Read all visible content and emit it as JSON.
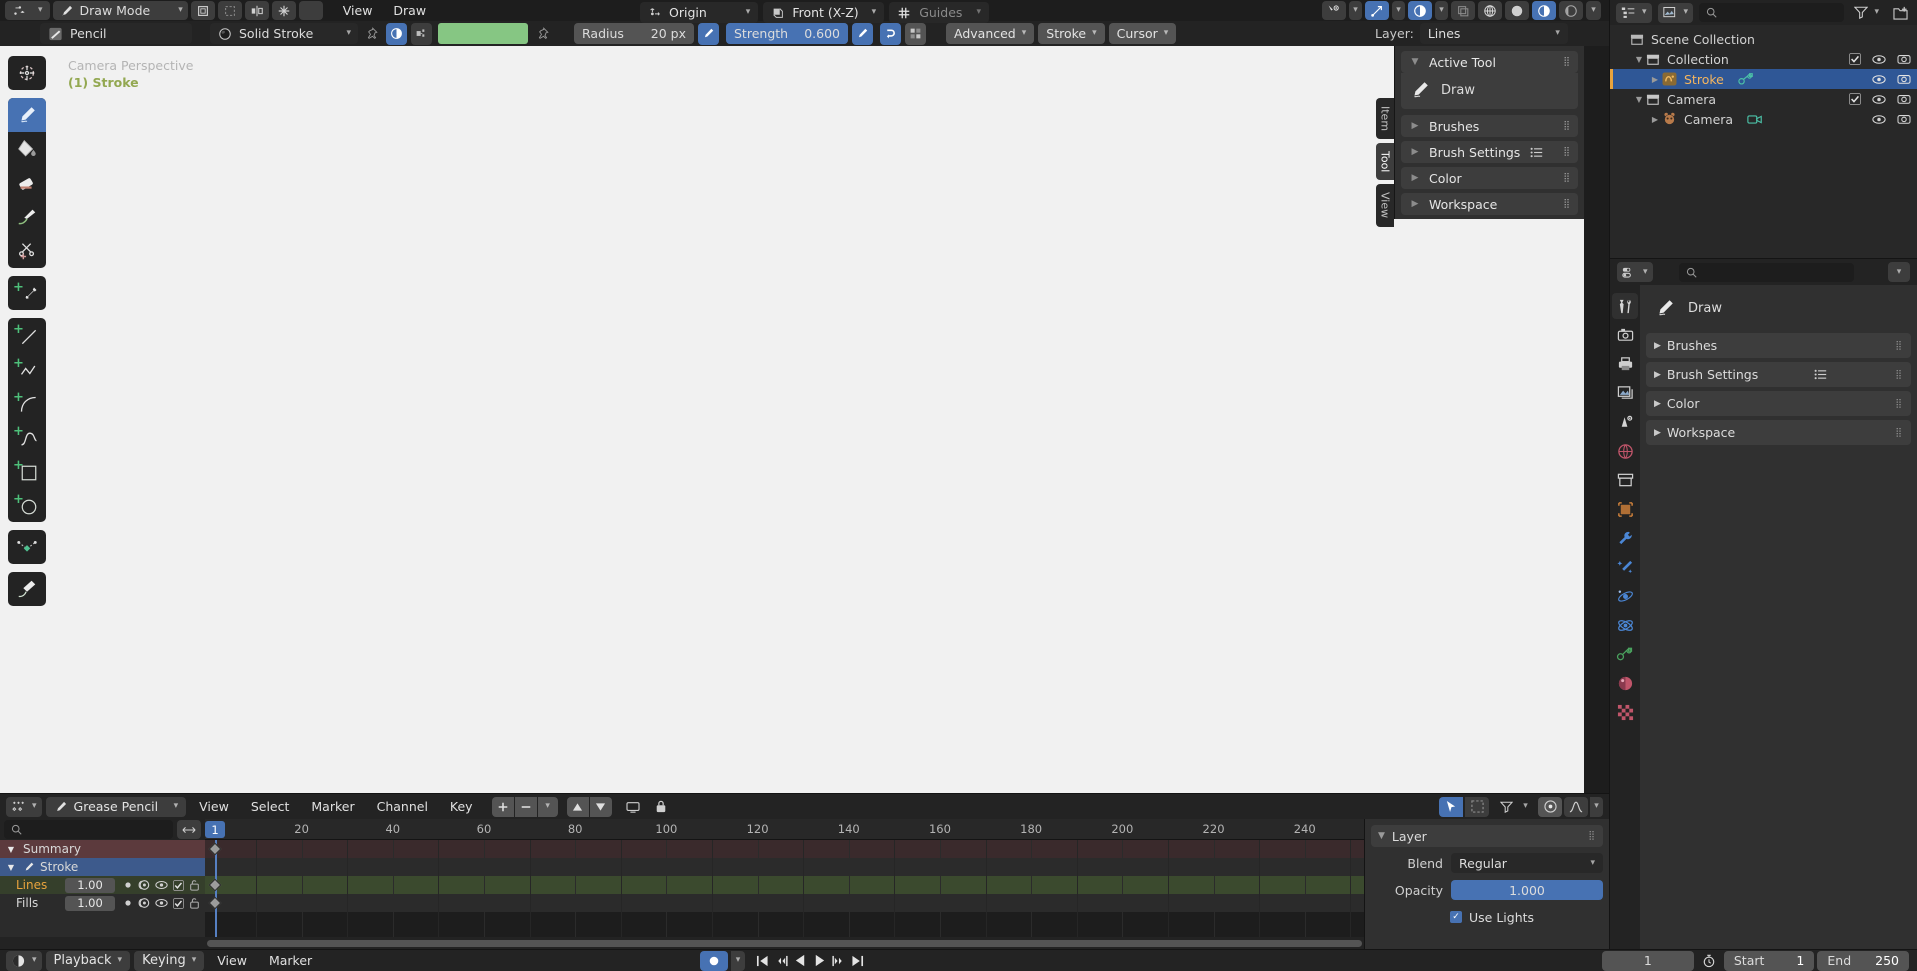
{
  "topbar": {
    "mode_label": "Draw Mode",
    "menus": [
      "View",
      "Draw"
    ],
    "icons": [
      "editor-type-icon",
      "mode-chevron-icon",
      "object-copy-icon",
      "select-set-icon",
      "mirror-icon",
      "snap-magnet-icon",
      "onion-skin-icon"
    ],
    "right_icons": [
      "visibility-selector-icon",
      "gizmo-icon",
      "overlays-icon",
      "xray-icon",
      "shading-wireframe-icon",
      "shading-solid-icon",
      "shading-material-icon",
      "shading-rendered-icon",
      "shading-chevron-icon"
    ]
  },
  "toolheader": {
    "brush_icon": "brush-preview-icon",
    "brush_name": "Pencil",
    "material_icon": "material-sphere-icon",
    "material_name": "Solid Stroke",
    "pin_icon": "pin-icon",
    "pressure_icon": "pressure-toggle-icon",
    "unlink_icon": "unlink-material-icon",
    "color_swatch": "#86c683",
    "color_pin_icon": "pin-icon",
    "radius_label": "Radius",
    "radius_value": "20 px",
    "radius_pressure_icon": "pressure-pen-icon",
    "strength_label": "Strength",
    "strength_value": "0.600",
    "strength_pressure_icon": "pressure-pen-icon",
    "caps_icon": "stroke-caps-icon",
    "blend_icon": "blend-mode-icon",
    "popovers": [
      "Advanced",
      "Stroke",
      "Cursor"
    ],
    "layer_label": "Layer:",
    "layer_value": "Lines"
  },
  "viewport": {
    "camera_text": "Camera Perspective",
    "object_text": "(1) Stroke",
    "background": "#f1f1f1",
    "tools": [
      {
        "name": "cursor-tool",
        "icon": "cursor-icon",
        "active": false
      },
      {
        "name": "draw-tool",
        "icon": "pencil-icon",
        "active": true
      },
      {
        "name": "fill-tool",
        "icon": "fill-bucket-icon",
        "active": false
      },
      {
        "name": "erase-tool",
        "icon": "eraser-icon",
        "active": false
      },
      {
        "name": "tint-tool",
        "icon": "tint-brush-icon",
        "active": false
      },
      {
        "name": "cutter-tool",
        "icon": "scissors-icon",
        "active": false
      },
      {
        "name": "eyedropper-tool",
        "icon": "eyedropper-icon",
        "active": false
      },
      {
        "name": "line-tool",
        "icon": "line-icon",
        "active": false
      },
      {
        "name": "polyline-tool",
        "icon": "polyline-icon",
        "active": false
      },
      {
        "name": "arc-tool",
        "icon": "arc-icon",
        "active": false
      },
      {
        "name": "curve-tool",
        "icon": "curve-icon",
        "active": false
      },
      {
        "name": "box-tool",
        "icon": "box-icon",
        "active": false
      },
      {
        "name": "circle-tool",
        "icon": "circle-icon",
        "active": false
      },
      {
        "name": "interpolate-tool",
        "icon": "interpolate-icon",
        "active": false
      },
      {
        "name": "annotate-tool",
        "icon": "annotate-icon",
        "active": false
      }
    ],
    "transform_pivot": "Origin",
    "view_orientation": "Front (X-Z)",
    "guides": "Guides"
  },
  "npanel": {
    "tabs": [
      "Item",
      "Tool",
      "View"
    ],
    "selected_tab": "Tool",
    "active_tool_header": "Active Tool",
    "active_tool_name": "Draw",
    "panels": [
      "Brushes",
      "Brush Settings",
      "Color",
      "Workspace"
    ]
  },
  "outliner": {
    "display_mode_icon": "outliner-display-mode-icon",
    "filter_icon": "filter-funnel-icon",
    "new_collection_icon": "new-collection-icon",
    "search_placeholder": "",
    "search_value": "",
    "rows": [
      {
        "label": "Scene Collection",
        "icon": "collection-icon",
        "indent": 0,
        "expand": "",
        "selected": false,
        "checkbox": false,
        "eye": false,
        "camera": false
      },
      {
        "label": "Collection",
        "icon": "collection-icon",
        "indent": 1,
        "expand": "down",
        "selected": false,
        "checkbox": true,
        "eye": true,
        "camera": true
      },
      {
        "label": "Stroke",
        "icon": "grease-pencil-data-icon",
        "indent": 2,
        "expand": "right",
        "selected": true,
        "checkbox": false,
        "eye": true,
        "camera": true,
        "extra_icon": "grease-pencil-object-icon"
      },
      {
        "label": "Camera",
        "icon": "collection-icon",
        "indent": 1,
        "expand": "down",
        "selected": false,
        "checkbox": true,
        "eye": true,
        "camera": true
      },
      {
        "label": "Camera",
        "icon": "camera-object-icon",
        "indent": 2,
        "expand": "right",
        "selected": false,
        "checkbox": false,
        "eye": true,
        "camera": true,
        "extra_icon": "camera-data-icon"
      }
    ]
  },
  "properties": {
    "editor_icon": "properties-editor-icon",
    "search_placeholder": "",
    "search_value": "",
    "tabs": [
      {
        "name": "tool-tab",
        "icon": "tool-wrench-screwdriver-icon",
        "selected": true,
        "color": "#d8d8d8"
      },
      {
        "name": "render-tab",
        "icon": "render-camera-back-icon",
        "selected": false,
        "color": "#d8d8d8"
      },
      {
        "name": "output-tab",
        "icon": "printer-icon",
        "selected": false,
        "color": "#d8d8d8"
      },
      {
        "name": "viewlayer-tab",
        "icon": "images-icon",
        "selected": false,
        "color": "#d8d8d8"
      },
      {
        "name": "scene-tab",
        "icon": "scene-cone-icon",
        "selected": false,
        "color": "#d8d8d8"
      },
      {
        "name": "world-tab",
        "icon": "world-globe-icon",
        "selected": false,
        "color": "#c0556a"
      },
      {
        "name": "collection-tab",
        "icon": "collection-box-icon",
        "selected": false,
        "color": "#d8d8d8"
      },
      {
        "name": "object-tab",
        "icon": "object-square-icon",
        "selected": false,
        "color": "#e08a3c"
      },
      {
        "name": "modifier-tab",
        "icon": "wrench-icon",
        "selected": false,
        "color": "#4b87d6"
      },
      {
        "name": "effects-tab",
        "icon": "sparkle-wand-icon",
        "selected": false,
        "color": "#4b87d6"
      },
      {
        "name": "particles-tab",
        "icon": "particles-icon",
        "selected": false,
        "color": "#4b87d6"
      },
      {
        "name": "physics-tab",
        "icon": "physics-orbit-icon",
        "selected": false,
        "color": "#4b87d6"
      },
      {
        "name": "data-tab",
        "icon": "grease-pencil-data-icon",
        "selected": false,
        "color": "#4aa35f"
      },
      {
        "name": "material-tab",
        "icon": "material-sphere-icon",
        "selected": false,
        "color": "#c0556a"
      },
      {
        "name": "texture-tab",
        "icon": "texture-checker-icon",
        "selected": false,
        "color": "#c0556a"
      }
    ],
    "active_tool_name": "Draw",
    "panels": [
      "Brushes",
      "Brush Settings",
      "Color",
      "Workspace"
    ]
  },
  "dopesheet": {
    "editor_icon": "dopesheet-editor-icon",
    "mode_icon": "grease-pencil-mode-icon",
    "mode_label": "Grease Pencil",
    "menus": [
      "View",
      "Select",
      "Marker",
      "Channel",
      "Key"
    ],
    "header_icons": [
      "add-keyframe-icon",
      "remove-keyframe-icon",
      "keyframe-chevron-icon",
      "move-up-icon",
      "move-down-icon",
      "only-show-selected-icon",
      "lock-icon"
    ],
    "right_icons": [
      "cursor-select-icon",
      "box-select-icon",
      "filter-funnel-icon",
      "proportional-edit-icon",
      "falloff-curve-icon"
    ],
    "search_placeholder": "",
    "search_value": "",
    "resize_icon": "horizontal-resize-icon",
    "channels": [
      {
        "label": "Summary",
        "type": "summary",
        "expand": "down"
      },
      {
        "label": "Stroke",
        "type": "object",
        "expand": "down",
        "icon": "grease-pencil-icon"
      },
      {
        "label": "Lines",
        "type": "layer",
        "value": "1.00",
        "icons": [
          "dot-icon",
          "onion-skin-icon",
          "eye-icon",
          "checkbox-icon",
          "unlock-icon"
        ]
      },
      {
        "label": "Fills",
        "type": "layer",
        "value": "1.00",
        "icons": [
          "dot-icon",
          "onion-skin-icon",
          "eye-icon",
          "checkbox-icon",
          "unlock-icon"
        ]
      }
    ],
    "ruler_ticks": [
      20,
      40,
      60,
      80,
      100,
      120,
      140,
      160,
      180,
      200,
      220,
      240
    ],
    "current_frame": 1,
    "keyframe_frame": 1,
    "keyframe_rows": [
      "summary",
      "lines",
      "fills"
    ],
    "sidepanel": {
      "header": "Layer",
      "blend_label": "Blend",
      "blend_value": "Regular",
      "opacity_label": "Opacity",
      "opacity_value": "1.000",
      "use_lights_label": "Use Lights",
      "use_lights_checked": true
    }
  },
  "bottombar": {
    "editor_icon": "timeline-editor-icon",
    "menus": [
      "Playback",
      "Keying",
      "View",
      "Marker"
    ],
    "keying_set_icon": "keying-set-icon",
    "transport_icons": [
      "jump-to-start-icon",
      "jump-to-prev-keyframe-icon",
      "play-reverse-icon",
      "play-icon",
      "jump-to-next-keyframe-icon",
      "jump-to-end-icon"
    ],
    "current_frame": "1",
    "autokey_icon": "auto-keying-icon",
    "start_label": "Start",
    "start_value": "1",
    "end_label": "End",
    "end_value": "250"
  },
  "colors": {
    "accent_blue": "#4772b3",
    "brush_color": "#86c683",
    "layer_orange": "#e8a33d",
    "summary_red": "#5c3a3d",
    "lines_green": "#3b4a2e",
    "object_blue": "#3d5a8c"
  }
}
